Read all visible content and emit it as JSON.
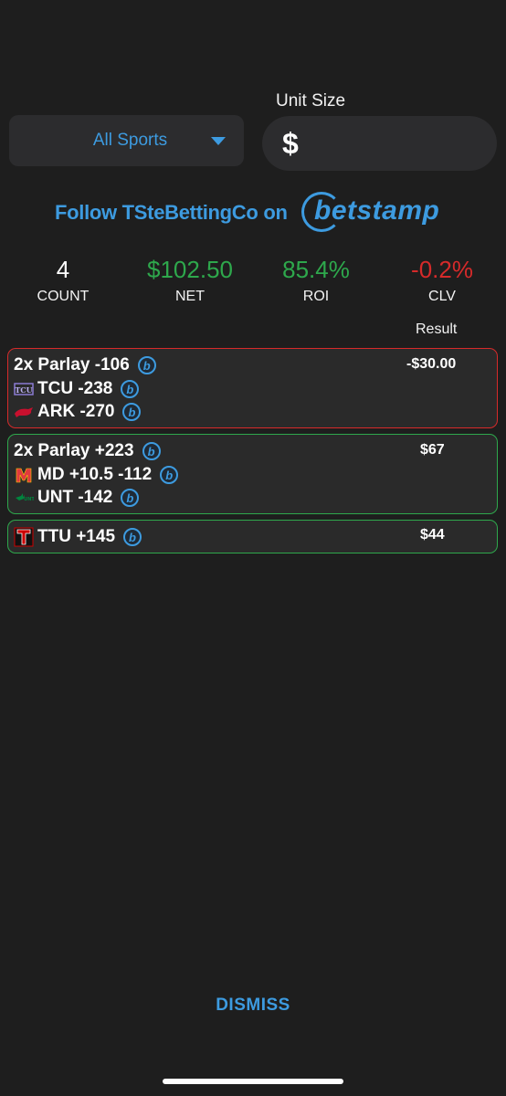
{
  "unit_size": {
    "label": "Unit Size",
    "currency_symbol": "$",
    "value": ""
  },
  "sport_filter": {
    "selected": "All Sports"
  },
  "follow": {
    "text": "Follow TSteBettingCo on",
    "brand": "betstamp"
  },
  "stats": [
    {
      "value": "4",
      "label": "COUNT",
      "color": "#ffffff"
    },
    {
      "value": "$102.50",
      "label": "NET",
      "color": "#2ea84c"
    },
    {
      "value": "85.4%",
      "label": "ROI",
      "color": "#2ea84c"
    },
    {
      "value": "-0.2%",
      "label": "CLV",
      "color": "#d62a2a"
    }
  ],
  "result_header": "Result",
  "bets": [
    {
      "status": "loss",
      "title": "2x Parlay -106",
      "result": "-$30.00",
      "legs": [
        {
          "team_icon": "tcu-logo-icon",
          "text": "TCU -238"
        },
        {
          "team_icon": "razorback-logo-icon",
          "text": "ARK -270"
        }
      ]
    },
    {
      "status": "win",
      "title": "2x Parlay +223",
      "result": "$67",
      "legs": [
        {
          "team_icon": "maryland-logo-icon",
          "text": "MD +10.5 -112"
        },
        {
          "team_icon": "unt-logo-icon",
          "text": "UNT -142"
        }
      ]
    },
    {
      "status": "win",
      "title": "",
      "result": "$44",
      "legs": [
        {
          "team_icon": "texas-tech-logo-icon",
          "text": "TTU +145"
        }
      ]
    }
  ],
  "b_icon_glyph": "b",
  "dismiss_label": "DISMISS"
}
